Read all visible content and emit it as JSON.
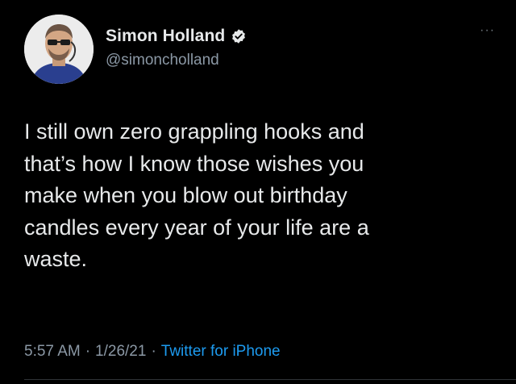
{
  "tweet": {
    "author": {
      "display_name": "Simon Holland",
      "handle": "@simoncholland",
      "verified": true
    },
    "more_label": "···",
    "text": "I still own zero grappling hooks and\nthat’s how I know those wishes you\nmake when you blow out birthday\ncandles every year of your life are a\nwaste.",
    "time": "5:57 AM",
    "separator": "·",
    "date": "1/26/21",
    "source": "Twitter for iPhone"
  },
  "colors": {
    "background": "#000000",
    "primary_text": "#e7e9ea",
    "secondary_text": "#8b98a5",
    "link": "#1d9bf0",
    "verified_badge": "#e7e9ea"
  },
  "icons": {
    "verified": "verified-badge-icon",
    "more": "more-options-icon"
  }
}
